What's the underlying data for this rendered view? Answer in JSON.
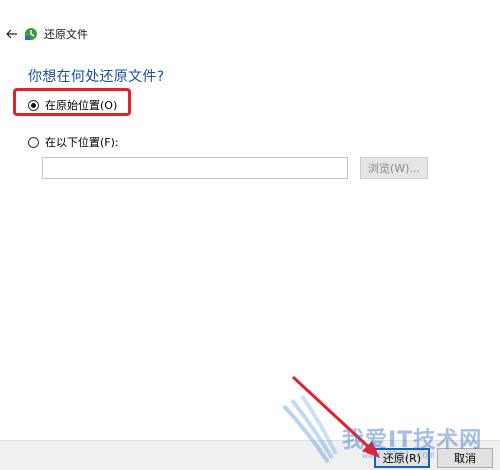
{
  "window": {
    "title": "还原文件"
  },
  "heading": "你想在何处还原文件?",
  "options": {
    "original": {
      "label": "在原始位置(O)",
      "checked": true
    },
    "other": {
      "label": "在以下位置(F):",
      "checked": false
    }
  },
  "path": {
    "value": "",
    "placeholder": ""
  },
  "buttons": {
    "browse": "浏览(W)...",
    "restore": "还原(R)",
    "cancel": "取消"
  },
  "watermark": {
    "text": "我爱IT技术网",
    "sub": "www.52ij.com"
  },
  "colors": {
    "accent": "#1a4fa0",
    "highlight": "#e4202d",
    "focus": "#0a64c8"
  }
}
